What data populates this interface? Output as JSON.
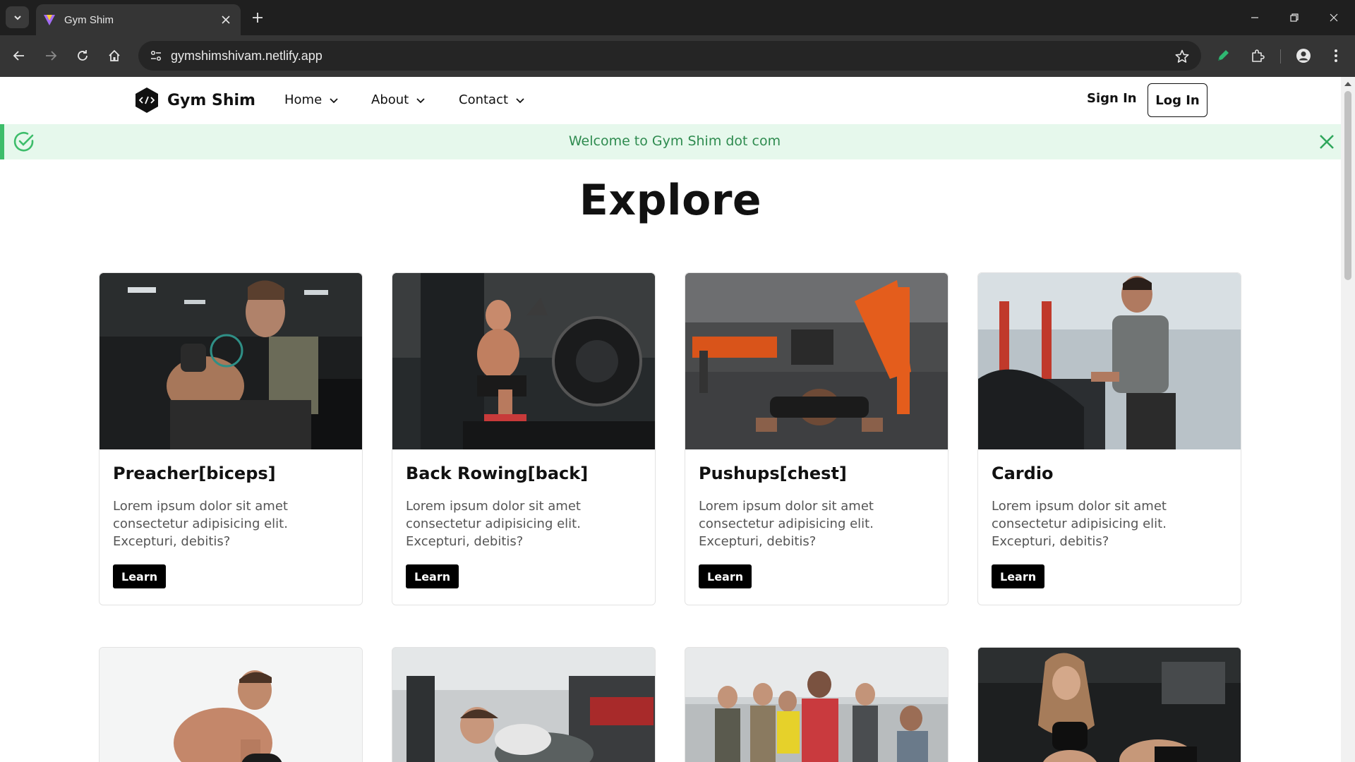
{
  "browser": {
    "tab_title": "Gym Shim",
    "url": "gymshimshivam.netlify.app"
  },
  "site": {
    "brand": "Gym Shim",
    "nav": [
      {
        "label": "Home"
      },
      {
        "label": "About"
      },
      {
        "label": "Contact"
      }
    ],
    "sign_in": "Sign In",
    "log_in": "Log In"
  },
  "alert": {
    "message": "Welcome to Gym Shim dot com"
  },
  "heading": "Explore",
  "cards": [
    {
      "title": "Preacher[biceps]",
      "text": "Lorem ipsum dolor sit amet consectetur adipisicing elit. Excepturi, debitis?",
      "button": "Learn"
    },
    {
      "title": "Back Rowing[back]",
      "text": "Lorem ipsum dolor sit amet consectetur adipisicing elit. Excepturi, debitis?",
      "button": "Learn"
    },
    {
      "title": "Pushups[chest]",
      "text": "Lorem ipsum dolor sit amet consectetur adipisicing elit. Excepturi, debitis?",
      "button": "Learn"
    },
    {
      "title": "Cardio",
      "text": "Lorem ipsum dolor sit amet consectetur adipisicing elit. Excepturi, debitis?",
      "button": "Learn"
    }
  ],
  "colors": {
    "alert_bg": "#e6f8ec",
    "alert_accent": "#3dbd6a",
    "alert_text": "#2e8b4f",
    "button_bg": "#000000"
  }
}
